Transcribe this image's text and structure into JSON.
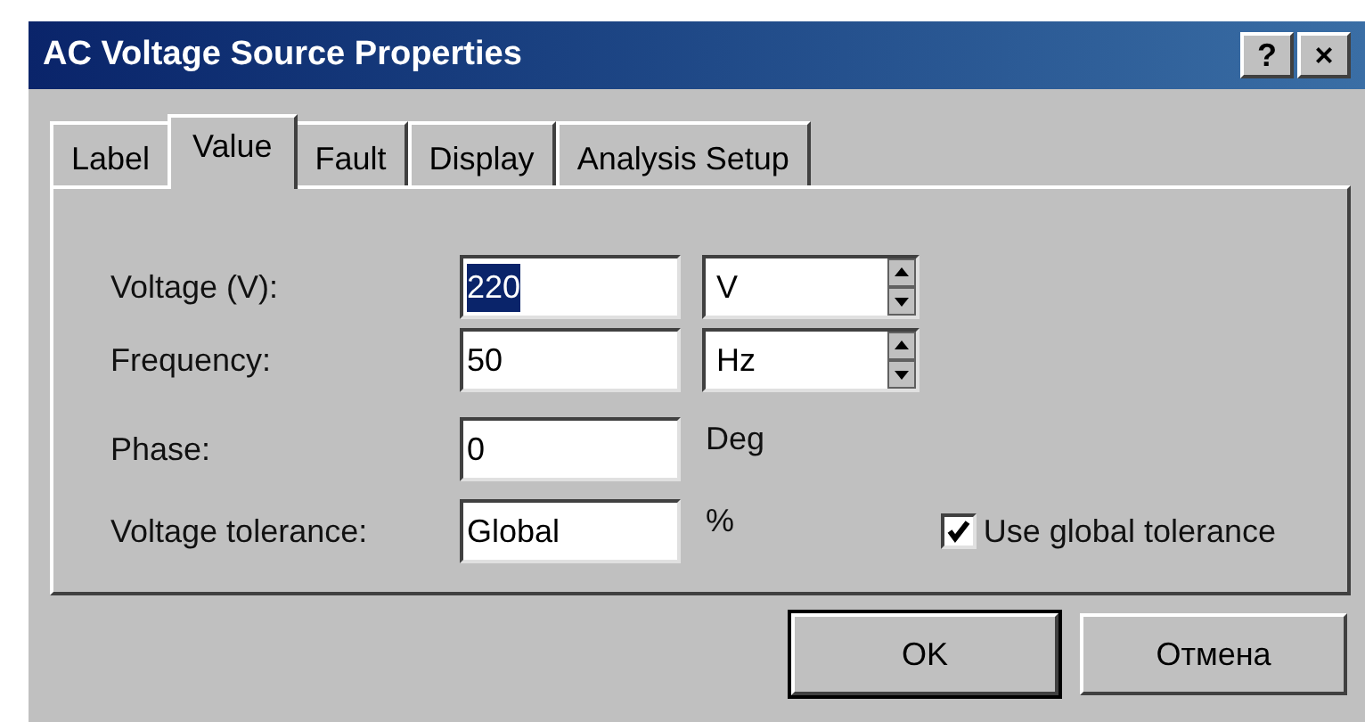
{
  "window": {
    "title": "AC Voltage Source Properties",
    "buttons": [
      "?",
      "×"
    ]
  },
  "tabs": [
    {
      "label": "Label",
      "selected": false
    },
    {
      "label": "Value",
      "selected": true
    },
    {
      "label": "Fault",
      "selected": false
    },
    {
      "label": "Display",
      "selected": false
    },
    {
      "label": "Analysis Setup",
      "selected": false
    }
  ],
  "fields": [
    {
      "label": "Voltage (V):",
      "value": "220",
      "highlighted": true,
      "kind": "spin",
      "unit": "V"
    },
    {
      "label": "Frequency:",
      "value": "50",
      "highlighted": false,
      "kind": "spin",
      "unit": "Hz"
    },
    {
      "label": "Phase:",
      "value": "0",
      "highlighted": false,
      "kind": "text",
      "unit": "Deg"
    },
    {
      "label": "Voltage tolerance:",
      "value": "Global",
      "highlighted": false,
      "kind": "text",
      "unit": "%"
    }
  ],
  "checkbox": {
    "label": "Use global tolerance",
    "checked": true
  },
  "buttons": [
    {
      "label": "OK",
      "default": true
    },
    {
      "label": "Отмена",
      "default": false
    }
  ]
}
